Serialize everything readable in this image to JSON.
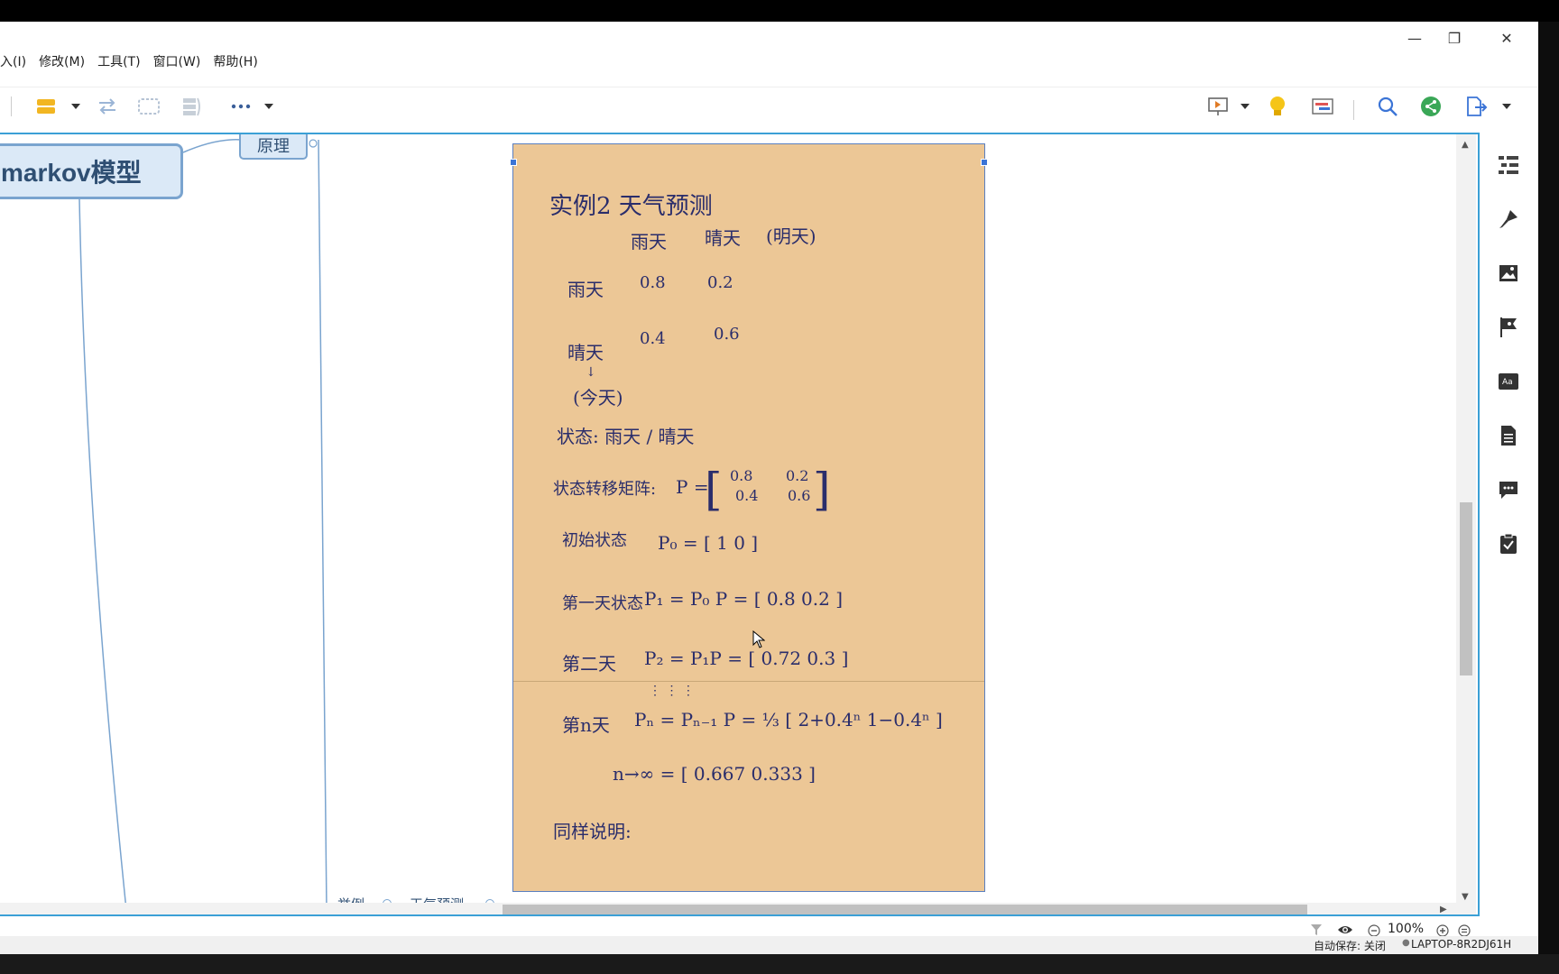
{
  "window_controls": {
    "minimize": "—",
    "restore": "❐",
    "close": "✕"
  },
  "menu": [
    "入(I)",
    "修改(M)",
    "工具(T)",
    "窗口(W)",
    "帮助(H)"
  ],
  "toolbar_icons": [
    "insert-topic-icon",
    "dropdown-icon",
    "relationship-icon",
    "boundary-icon",
    "summary-icon",
    "more-icon",
    "dropdown-icon",
    "presentation-icon",
    "dropdown-icon",
    "idea-lightbulb-icon",
    "gantt-icon",
    "search-icon",
    "share-icon",
    "export-icon",
    "dropdown-icon"
  ],
  "mindmap": {
    "central_topic": "markov模型",
    "topic_yuanli": "原理",
    "sub_example": "举例",
    "sub_weather": "天气预测"
  },
  "note": {
    "title": "实例2 天气预测",
    "col_headers": [
      "雨天",
      "晴天",
      "(明天)"
    ],
    "row1_label": "雨天",
    "row1_vals": [
      "0.8",
      "0.2"
    ],
    "row2_label": "晴天",
    "row2_vals": [
      "0.4",
      "0.6"
    ],
    "today_label": "(今天)",
    "state_line": "状态:  雨天 / 晴天",
    "transition_label": "状态转移矩阵:",
    "transition_p": "P =",
    "matrix": [
      "0.8",
      "0.2",
      "0.4",
      "0.6"
    ],
    "initial_label": "初始状态",
    "initial_eq": "P₀ = [ 1    0 ]",
    "day1_label": "第一天状态",
    "day1_eq": "P₁ = P₀ P = [ 0.8    0.2 ]",
    "day2_label": "第二天",
    "day2_eq": "P₂ = P₁P = [ 0.72   0.3 ]",
    "dots": "⋮  ⋮  ⋮",
    "dayn_label": "第n天",
    "dayn_eq": "Pₙ = Pₙ₋₁ P = ⅓ [ 2+0.4ⁿ    1−0.4ⁿ ]",
    "limit_eq": "n→∞        = [ 0.667    0.333 ]",
    "conclusion": "同样说明:"
  },
  "side_panel_icons": [
    "outline-icon",
    "format-brush-icon",
    "image-icon",
    "marker-flag-icon",
    "text-style-icon",
    "notes-icon",
    "comment-icon",
    "task-icon"
  ],
  "zoom": {
    "value": "100%"
  },
  "status": {
    "autosave": "自动保存: 关闭",
    "computer": "LAPTOP-8R2DJ61H"
  }
}
